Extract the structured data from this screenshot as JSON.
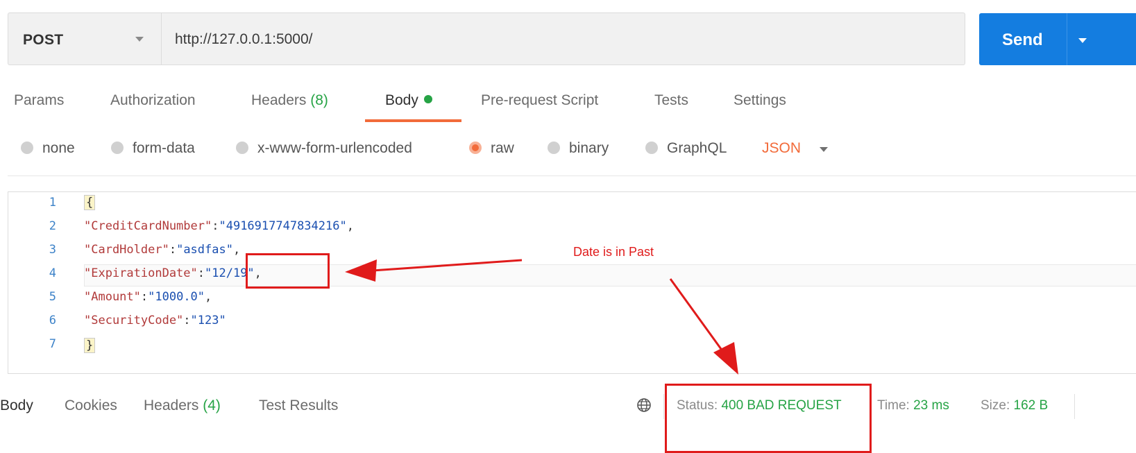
{
  "request": {
    "method": "POST",
    "url": "http://127.0.0.1:5000/",
    "send_label": "Send"
  },
  "tabs": {
    "params": "Params",
    "authorization": "Authorization",
    "headers_label": "Headers",
    "headers_count": "(8)",
    "body": "Body",
    "prerequest": "Pre-request Script",
    "tests": "Tests",
    "settings": "Settings"
  },
  "body_types": {
    "none": "none",
    "form_data": "form-data",
    "urlencoded": "x-www-form-urlencoded",
    "raw": "raw",
    "binary": "binary",
    "graphql": "GraphQL",
    "selected": "raw",
    "format": "JSON"
  },
  "editor": {
    "line_numbers": [
      "1",
      "2",
      "3",
      "4",
      "5",
      "6",
      "7"
    ],
    "lines": [
      {
        "open": "{"
      },
      {
        "key": "\"CreditCardNumber\"",
        "colon": ":",
        "value": "\"4916917747834216\"",
        "comma": ","
      },
      {
        "key": "\"CardHolder\"",
        "colon": ":",
        "value": "\"asdfas\"",
        "comma": ","
      },
      {
        "key": "\"ExpirationDate\"",
        "colon": ":",
        "value": "\"12/19\"",
        "comma": ","
      },
      {
        "key": "\"Amount\"",
        "colon": ":",
        "value": "\"1000.0\"",
        "comma": ","
      },
      {
        "key": "\"SecurityCode\"",
        "colon": ":",
        "value": "\"123\"",
        "comma": ""
      },
      {
        "close": "}"
      }
    ]
  },
  "annotation": {
    "note": "Date is in Past",
    "color": "#e01b1b"
  },
  "response": {
    "tabs": {
      "body": "Body",
      "cookies": "Cookies",
      "headers_label": "Headers",
      "headers_count": "(4)",
      "test_results": "Test Results"
    },
    "status_label": "Status:",
    "status_value": "400 BAD REQUEST",
    "time_label": "Time:",
    "time_value": "23 ms",
    "size_label": "Size:",
    "size_value": "162 B",
    "globe_icon": "globe-icon"
  },
  "colors": {
    "accent": "#f26b3a",
    "send": "#147de0",
    "success": "#26a345"
  }
}
